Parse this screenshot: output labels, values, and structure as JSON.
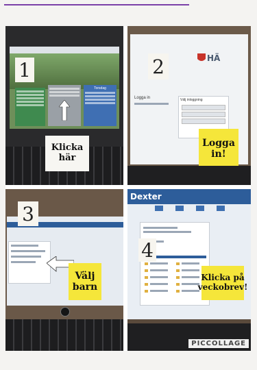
{
  "collage": {
    "step1": {
      "number": "1",
      "note_line1": "Klicka",
      "note_line2": "här",
      "card_green_label": "Tidigare",
      "card_blue_label": "Torsdag"
    },
    "step2": {
      "number": "2",
      "note_line1": "Logga",
      "note_line2": "in!",
      "site_name": "HÄ",
      "login_title": "Logga in",
      "login_box_title": "Välj inloggning"
    },
    "step3": {
      "number": "3",
      "note_line1": "Välj",
      "note_line2": "barn"
    },
    "step4": {
      "number": "4",
      "note_line1": "Klicka på",
      "note_line2": "veckobrev!",
      "brand": "Dexter"
    },
    "watermark": "PICCOLLAGE"
  },
  "colors": {
    "note_yellow": "#f5e63a",
    "note_white": "#f7f6f2",
    "dexter_blue": "#2d5d9a"
  }
}
